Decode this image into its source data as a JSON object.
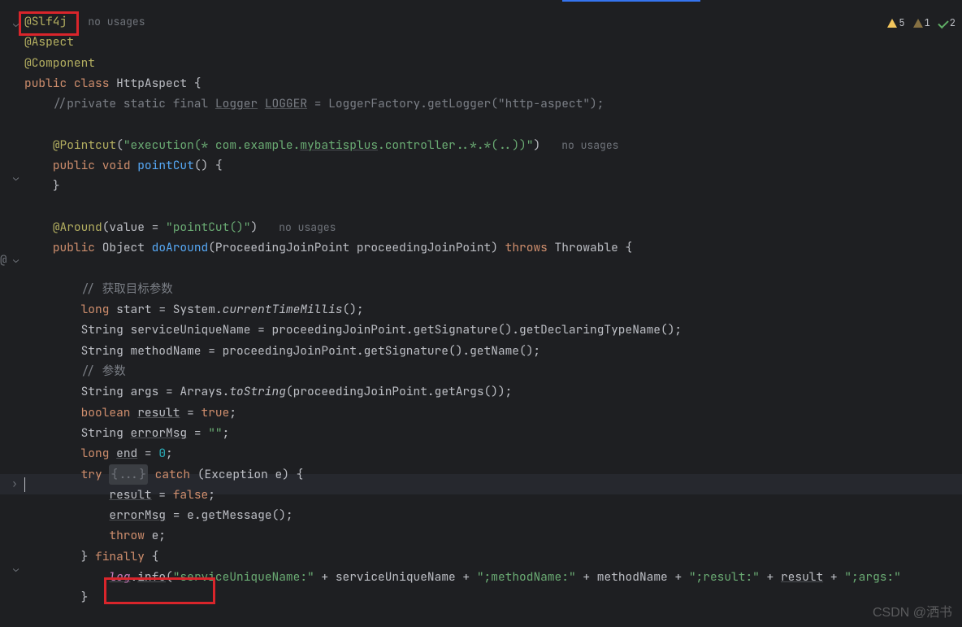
{
  "status": {
    "warn_strong": "5",
    "warn_weak": "1",
    "ok": "2"
  },
  "hints": {
    "no_usages": "no usages"
  },
  "code": {
    "l1_ann": "@Slf4j",
    "l2_ann": "@Aspect",
    "l3_ann": "@Component",
    "l4_kw1": "public",
    "l4_kw2": "class",
    "l4_name": "HttpAspect",
    "l4_brace": " {",
    "l5_c": "//private static final ",
    "l5_logger": "Logger",
    "l5_sp": " ",
    "l5_var": "LOGGER",
    "l5_rest": " = LoggerFactory.getLogger(\"http-aspect\");",
    "l7_ann": "@Pointcut",
    "l7_p1": "(",
    "l7_str": "\"execution(* com.example.",
    "l7_mid": "mybatisplus",
    "l7_str2": ".controller..*.*(..))\"",
    "l7_p2": ")",
    "l8_kw1": "public",
    "l8_kw2": "void",
    "l8_name": "pointCut",
    "l8_rest": "() {",
    "l9": "}",
    "l11_ann": "@Around",
    "l11_p1": "(",
    "l11_val": "value = ",
    "l11_str": "\"pointCut()\"",
    "l11_p2": ")",
    "l12_kw1": "public",
    "l12_type": "Object",
    "l12_name": "doAround",
    "l12_p1": "(ProceedingJoinPoint proceedingJoinPoint) ",
    "l12_kw2": "throws",
    "l12_exc": " Throwable {",
    "l14_c": "// 获取目标参数",
    "l15_kw": "long",
    "l15_var": " start = System.",
    "l15_m": "currentTimeMillis",
    "l15_end": "();",
    "l16_t": "String serviceUniqueName = proceedingJoinPoint.getSignature().getDeclaringTypeName();",
    "l17_t": "String methodName = proceedingJoinPoint.getSignature().getName();",
    "l18_c": "// 参数",
    "l19_a": "String args = Arrays.",
    "l19_m": "toString",
    "l19_b": "(proceedingJoinPoint.getArgs());",
    "l20_kw": "boolean",
    "l20_sp": " ",
    "l20_v": "result",
    "l20_r": " = ",
    "l20_true": "true",
    "l20_end": ";",
    "l21_a": "String ",
    "l21_v": "errorMsg",
    "l21_r": " = ",
    "l21_s": "\"\"",
    "l21_end": ";",
    "l22_kw": "long",
    "l22_sp": " ",
    "l22_v": "end",
    "l22_r": " = ",
    "l22_n": "0",
    "l22_end": ";",
    "l23_kw": "try",
    "l23_fold": "{...}",
    "l23_kw2": " catch ",
    "l23_exc": "(Exception e) {",
    "l24_v": "result",
    "l24_r": " = ",
    "l24_false": "false",
    "l24_end": ";",
    "l25_v": "errorMsg",
    "l25_r": " = e.getMessage();",
    "l26_kw": "throw",
    "l26_r": " e;",
    "l27_a": "} ",
    "l27_kw": "finally",
    "l27_b": " {",
    "l28_log": "log",
    "l28_dot": ".",
    "l28_info": "info",
    "l28_p": "(",
    "l28_s1": "\"serviceUniqueName:\"",
    "l28_p1": " + serviceUniqueName + ",
    "l28_s2": "\";methodName:\"",
    "l28_p2": " + methodName + ",
    "l28_s3": "\";result:\"",
    "l28_p3": " + ",
    "l28_res": "result",
    "l28_p4": " + ",
    "l28_s4": "\";args:\"",
    "l29": "}"
  },
  "watermark": "CSDN @洒书"
}
